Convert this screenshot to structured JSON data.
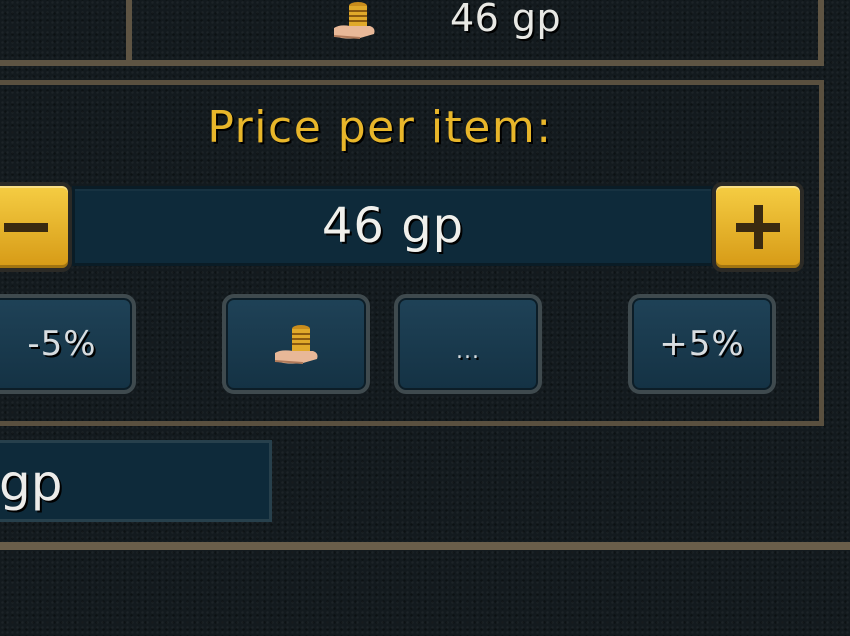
{
  "top_row": {
    "price_text": "46 gp",
    "icon": "coin-stack-icon"
  },
  "price_panel": {
    "title": "Price per item:",
    "price_value": "46 gp",
    "decrease_icon": "minus-icon",
    "increase_icon": "plus-icon",
    "buttons": {
      "minus_5": "-5%",
      "guide_price_icon": "coin-stack-icon",
      "custom": "...",
      "plus_5": "+5%"
    }
  },
  "lower_field": {
    "value": "gp"
  },
  "colors": {
    "gold_text": "#e8b62a",
    "panel_border": "#5a503f",
    "field_bg": "#0e2a3a",
    "gold_button": "#f5cd43"
  }
}
